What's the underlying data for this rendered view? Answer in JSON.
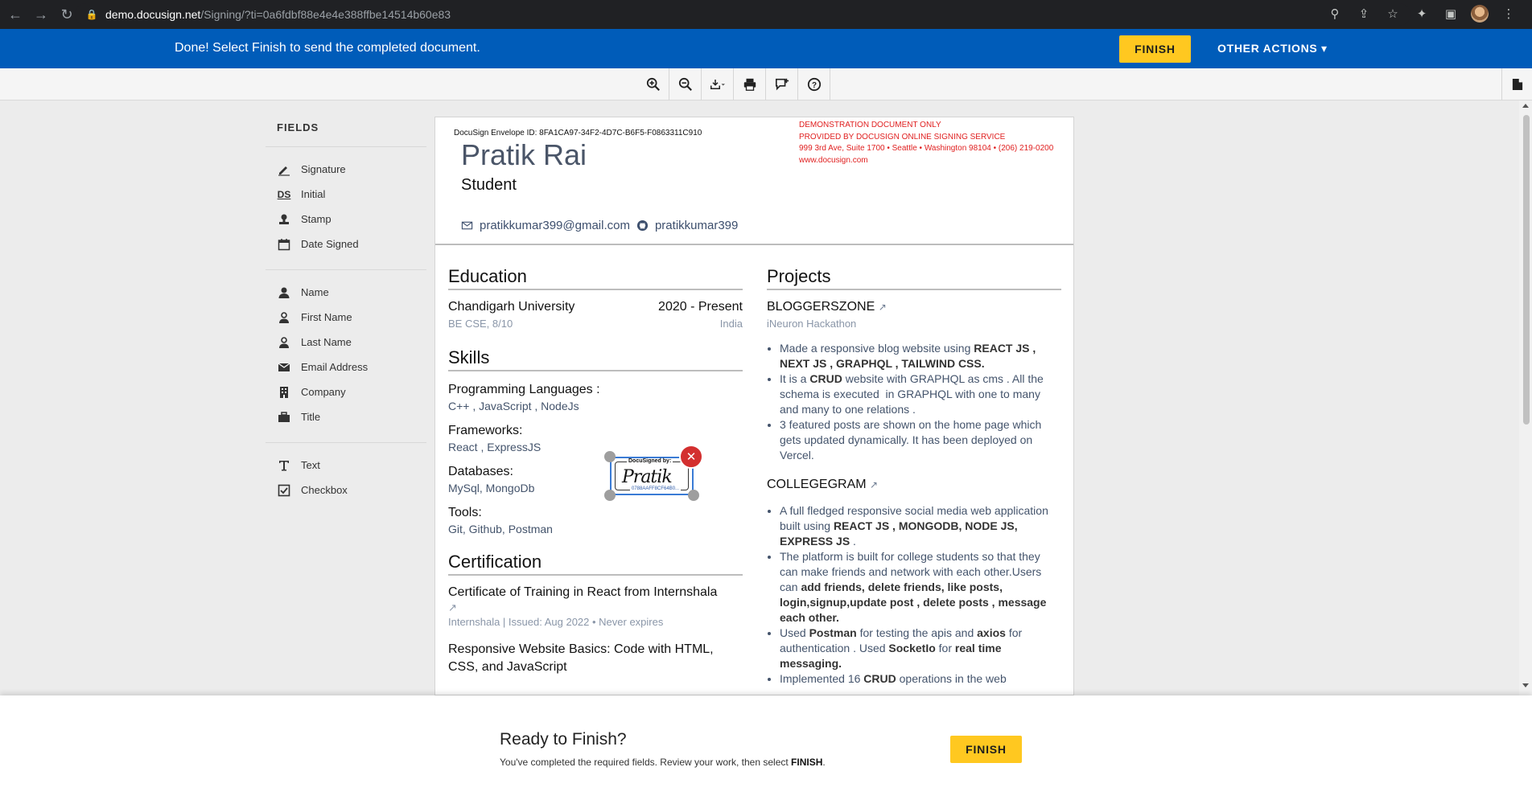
{
  "browser": {
    "url_host": "demo.docusign.net",
    "url_path": "/Signing/?ti=0a6fdbf88e4e4e388ffbe14514b60e83"
  },
  "topbar": {
    "message": "Done! Select Finish to send the completed document.",
    "finish_label": "FINISH",
    "other_actions_label": "OTHER ACTIONS ▾"
  },
  "fields_panel": {
    "title": "FIELDS",
    "groups": [
      [
        {
          "label": "Signature",
          "icon": "pen-icon"
        },
        {
          "label": "Initial",
          "icon": "ds-initial-icon"
        },
        {
          "label": "Stamp",
          "icon": "stamp-icon"
        },
        {
          "label": "Date Signed",
          "icon": "calendar-icon"
        }
      ],
      [
        {
          "label": "Name",
          "icon": "person-icon"
        },
        {
          "label": "First Name",
          "icon": "person-outline-icon"
        },
        {
          "label": "Last Name",
          "icon": "person-outline-icon"
        },
        {
          "label": "Email Address",
          "icon": "envelope-icon"
        },
        {
          "label": "Company",
          "icon": "building-icon"
        },
        {
          "label": "Title",
          "icon": "briefcase-icon"
        }
      ],
      [
        {
          "label": "Text",
          "icon": "text-icon"
        },
        {
          "label": "Checkbox",
          "icon": "checkbox-icon"
        }
      ]
    ]
  },
  "document": {
    "envelope_id": "DocuSign Envelope ID: 8FA1CA97-34F2-4D7C-B6F5-F0863311C910",
    "demo_lines": [
      "DEMONSTRATION DOCUMENT ONLY",
      "PROVIDED BY DOCUSIGN ONLINE SIGNING SERVICE",
      "999 3rd Ave, Suite 1700  • Seattle • Washington 98104 • (206) 219-0200",
      "www.docusign.com"
    ],
    "name": "Pratik Rai",
    "role": "Student",
    "email": "pratikkumar399@gmail.com",
    "github": "pratikkumar399",
    "education": {
      "title": "Education",
      "school": "Chandigarh University",
      "years": "2020 - Present",
      "degree": "BE CSE, 8/10",
      "location": "India"
    },
    "skills": {
      "title": "Skills",
      "items": [
        {
          "heading": "Programming Languages :",
          "value": "C++ , JavaScript , NodeJs"
        },
        {
          "heading": "Frameworks:",
          "value": "React , ExpressJS"
        },
        {
          "heading": "Databases:",
          "value": "MySql, MongoDb"
        },
        {
          "heading": "Tools:",
          "value": "Git, Github, Postman"
        }
      ]
    },
    "certification": {
      "title": "Certification",
      "cert1_title": "Certificate of Training in React from Internshala",
      "cert1_meta": "Internshala | Issued: Aug 2022 • Never expires",
      "cert2_title": "Responsive Website Basics: Code with HTML, CSS, and JavaScript"
    },
    "projects": {
      "title": "Projects",
      "p1_title": "BLOGGERSZONE",
      "p1_sub": "iNeuron Hackathon",
      "p2_title": "COLLEGEGRAM"
    },
    "signature": {
      "header": "DocuSigned by:",
      "script": "Pratik",
      "footer": "0788AAFF8CF64B0..."
    }
  },
  "ready_panel": {
    "title": "Ready to Finish?",
    "text_prefix": "You've completed the required fields. Review your work, then select ",
    "text_bold": "FINISH",
    "text_suffix": ".",
    "finish_label": "FINISH"
  }
}
